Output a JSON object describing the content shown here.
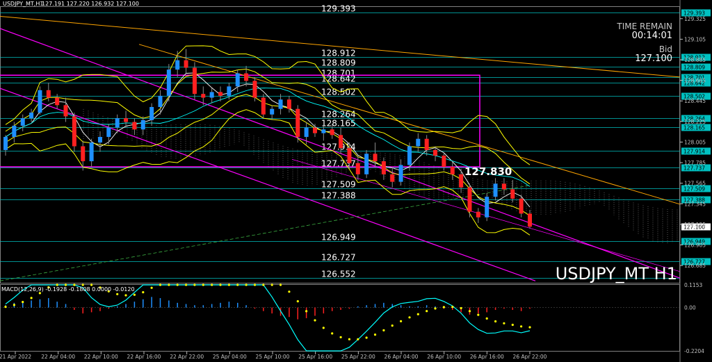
{
  "header": {
    "symbol_line": "USDJPY_MT,H1",
    "ohlc": "127.191 127.220 126.932 127.100"
  },
  "time_remain": {
    "label": "TIME REMAIN",
    "value": "00:14:01"
  },
  "bid": {
    "label": "Bid",
    "value": "127.100"
  },
  "watermark": "USDJPY_MT H1",
  "price_axis": {
    "min": 126.5,
    "max": 129.45,
    "ticks": [
      "129.325",
      "129.105",
      "128.885",
      "128.665",
      "128.445",
      "128.225",
      "128.005",
      "127.785",
      "127.565",
      "127.345",
      "127.125",
      "126.905",
      "126.685"
    ]
  },
  "levels": [
    {
      "value": "129.393",
      "label": "129.393",
      "box": "129.393"
    },
    {
      "value": "128.912",
      "label": "128.912",
      "box": "128.912"
    },
    {
      "value": "128.809",
      "label": "128.809",
      "box": "128.809"
    },
    {
      "value": "128.701",
      "label": "128.701",
      "box": "128.701"
    },
    {
      "value": "128.642",
      "label": "128.642",
      "box": "128.642"
    },
    {
      "value": "128.502",
      "label": "128.502",
      "box": "128.502"
    },
    {
      "value": "128.264",
      "label": "128.264",
      "box": "128.264"
    },
    {
      "value": "128.165",
      "label": "128.165",
      "box": "128.165"
    },
    {
      "value": "127.914",
      "label": "127.914",
      "box": "127.914"
    },
    {
      "value": "127.737",
      "label": "127.737",
      "box": "127.737"
    },
    {
      "value": "127.509",
      "label": "127.509",
      "box": "127.509"
    },
    {
      "value": "127.388",
      "label": "127.388",
      "box": "127.388"
    },
    {
      "value": "126.949",
      "label": "126.949",
      "box": "126.949"
    },
    {
      "value": "126.727",
      "label": "126.727",
      "box": "126.727"
    },
    {
      "value": "126.552",
      "label": "126.552",
      "box": ""
    }
  ],
  "current_price_box": "127.100",
  "marker_label": "127.830",
  "macd": {
    "label": "MACD(12,26,9) -0.1928 -0.1808 0.0000 -0.0120",
    "axis": [
      "0.1153",
      "0.00",
      "-0.2204"
    ]
  },
  "time_axis": [
    "21 Apr 2022",
    "22 Apr 04:00",
    "22 Apr 10:00",
    "22 Apr 16:00",
    "22 Apr 22:00",
    "25 Apr 04:00",
    "25 Apr 10:00",
    "25 Apr 16:00",
    "25 Apr 22:00",
    "26 Apr 04:00",
    "26 Apr 10:00",
    "26 Apr 16:00",
    "26 Apr 22:00"
  ],
  "colors": {
    "background": "#000000",
    "bull": "#1e90ff",
    "bear": "#ff2020",
    "grid": "#00c0c0",
    "bollinger": "#ffff00",
    "magenta": "#ff00ff",
    "orange": "#ffa500",
    "ma_white": "#ffffff",
    "ma_cyan": "#00ffff"
  },
  "chart_data": {
    "type": "candlestick",
    "ylim": [
      126.5,
      129.45
    ],
    "candles": [
      [
        127.92,
        128.08,
        127.86,
        128.06
      ],
      [
        128.06,
        128.22,
        128.0,
        128.18
      ],
      [
        128.18,
        128.3,
        128.12,
        128.26
      ],
      [
        128.26,
        128.36,
        128.22,
        128.32
      ],
      [
        128.32,
        128.6,
        128.3,
        128.56
      ],
      [
        128.56,
        128.64,
        128.44,
        128.48
      ],
      [
        128.48,
        128.52,
        128.36,
        128.4
      ],
      [
        128.4,
        128.48,
        128.22,
        128.28
      ],
      [
        128.28,
        128.32,
        127.9,
        127.96
      ],
      [
        127.96,
        128.02,
        127.7,
        127.8
      ],
      [
        127.8,
        128.04,
        127.74,
        128.0
      ],
      [
        128.0,
        128.12,
        127.9,
        128.06
      ],
      [
        128.06,
        128.2,
        127.98,
        128.16
      ],
      [
        128.16,
        128.3,
        128.1,
        128.26
      ],
      [
        128.26,
        128.34,
        128.16,
        128.22
      ],
      [
        128.22,
        128.26,
        128.08,
        128.14
      ],
      [
        128.14,
        128.28,
        128.08,
        128.24
      ],
      [
        128.24,
        128.42,
        128.18,
        128.38
      ],
      [
        128.38,
        128.56,
        128.3,
        128.5
      ],
      [
        128.5,
        128.84,
        128.44,
        128.78
      ],
      [
        128.78,
        128.98,
        128.7,
        128.88
      ],
      [
        128.88,
        129.0,
        128.74,
        128.8
      ],
      [
        128.8,
        128.86,
        128.46,
        128.52
      ],
      [
        128.52,
        128.6,
        128.4,
        128.48
      ],
      [
        128.48,
        128.58,
        128.42,
        128.54
      ],
      [
        128.54,
        128.6,
        128.44,
        128.5
      ],
      [
        128.5,
        128.64,
        128.46,
        128.6
      ],
      [
        128.6,
        128.78,
        128.54,
        128.74
      ],
      [
        128.74,
        128.82,
        128.6,
        128.66
      ],
      [
        128.66,
        128.7,
        128.44,
        128.48
      ],
      [
        128.48,
        128.52,
        128.26,
        128.3
      ],
      [
        128.3,
        128.4,
        128.24,
        128.36
      ],
      [
        128.36,
        128.52,
        128.3,
        128.46
      ],
      [
        128.46,
        128.5,
        128.32,
        128.36
      ],
      [
        128.36,
        128.4,
        128.0,
        128.06
      ],
      [
        128.06,
        128.22,
        127.98,
        128.16
      ],
      [
        128.16,
        128.2,
        128.06,
        128.1
      ],
      [
        128.1,
        128.18,
        128.02,
        128.14
      ],
      [
        128.14,
        128.2,
        128.04,
        128.08
      ],
      [
        128.08,
        128.16,
        127.88,
        127.94
      ],
      [
        127.94,
        128.0,
        127.72,
        127.78
      ],
      [
        127.78,
        127.86,
        127.6,
        127.66
      ],
      [
        127.66,
        127.92,
        127.62,
        127.88
      ],
      [
        127.88,
        128.0,
        127.74,
        127.8
      ],
      [
        127.8,
        127.84,
        127.6,
        127.66
      ],
      [
        127.66,
        127.74,
        127.52,
        127.58
      ],
      [
        127.58,
        127.82,
        127.54,
        127.76
      ],
      [
        127.76,
        128.0,
        127.7,
        127.96
      ],
      [
        127.96,
        128.1,
        127.9,
        128.04
      ],
      [
        128.04,
        128.08,
        127.86,
        127.92
      ],
      [
        127.92,
        127.96,
        127.8,
        127.86
      ],
      [
        127.86,
        127.9,
        127.7,
        127.74
      ],
      [
        127.74,
        127.8,
        127.6,
        127.66
      ],
      [
        127.66,
        127.72,
        127.46,
        127.52
      ],
      [
        127.52,
        127.56,
        127.2,
        127.26
      ],
      [
        127.26,
        127.3,
        127.14,
        127.2
      ],
      [
        127.2,
        127.46,
        127.16,
        127.42
      ],
      [
        127.42,
        127.62,
        127.38,
        127.56
      ],
      [
        127.56,
        127.62,
        127.44,
        127.5
      ],
      [
        127.5,
        127.6,
        127.36,
        127.4
      ],
      [
        127.4,
        127.44,
        127.2,
        127.24
      ],
      [
        127.24,
        127.28,
        127.08,
        127.1
      ]
    ],
    "macd_hist": [
      0.02,
      0.04,
      0.05,
      0.06,
      0.07,
      0.08,
      0.05,
      0.03,
      -0.02,
      -0.05,
      -0.04,
      -0.03,
      -0.01,
      0.01,
      0.03,
      0.05,
      0.07,
      0.09,
      0.08,
      0.06,
      0.04,
      0.03,
      0.02,
      0.02,
      0.03,
      0.04,
      0.05,
      0.04,
      0.02,
      -0.01,
      -0.03,
      -0.05,
      -0.07,
      -0.08,
      -0.1,
      -0.09,
      -0.07,
      -0.05,
      -0.03,
      -0.02,
      -0.01,
      0.01,
      0.02,
      0.03,
      0.04,
      0.03,
      0.02,
      0.01,
      0.01,
      0.02,
      0.01,
      -0.01,
      -0.02,
      -0.04,
      -0.06,
      -0.05,
      -0.04,
      -0.02,
      -0.01,
      -0.02,
      -0.03,
      -0.01
    ]
  }
}
